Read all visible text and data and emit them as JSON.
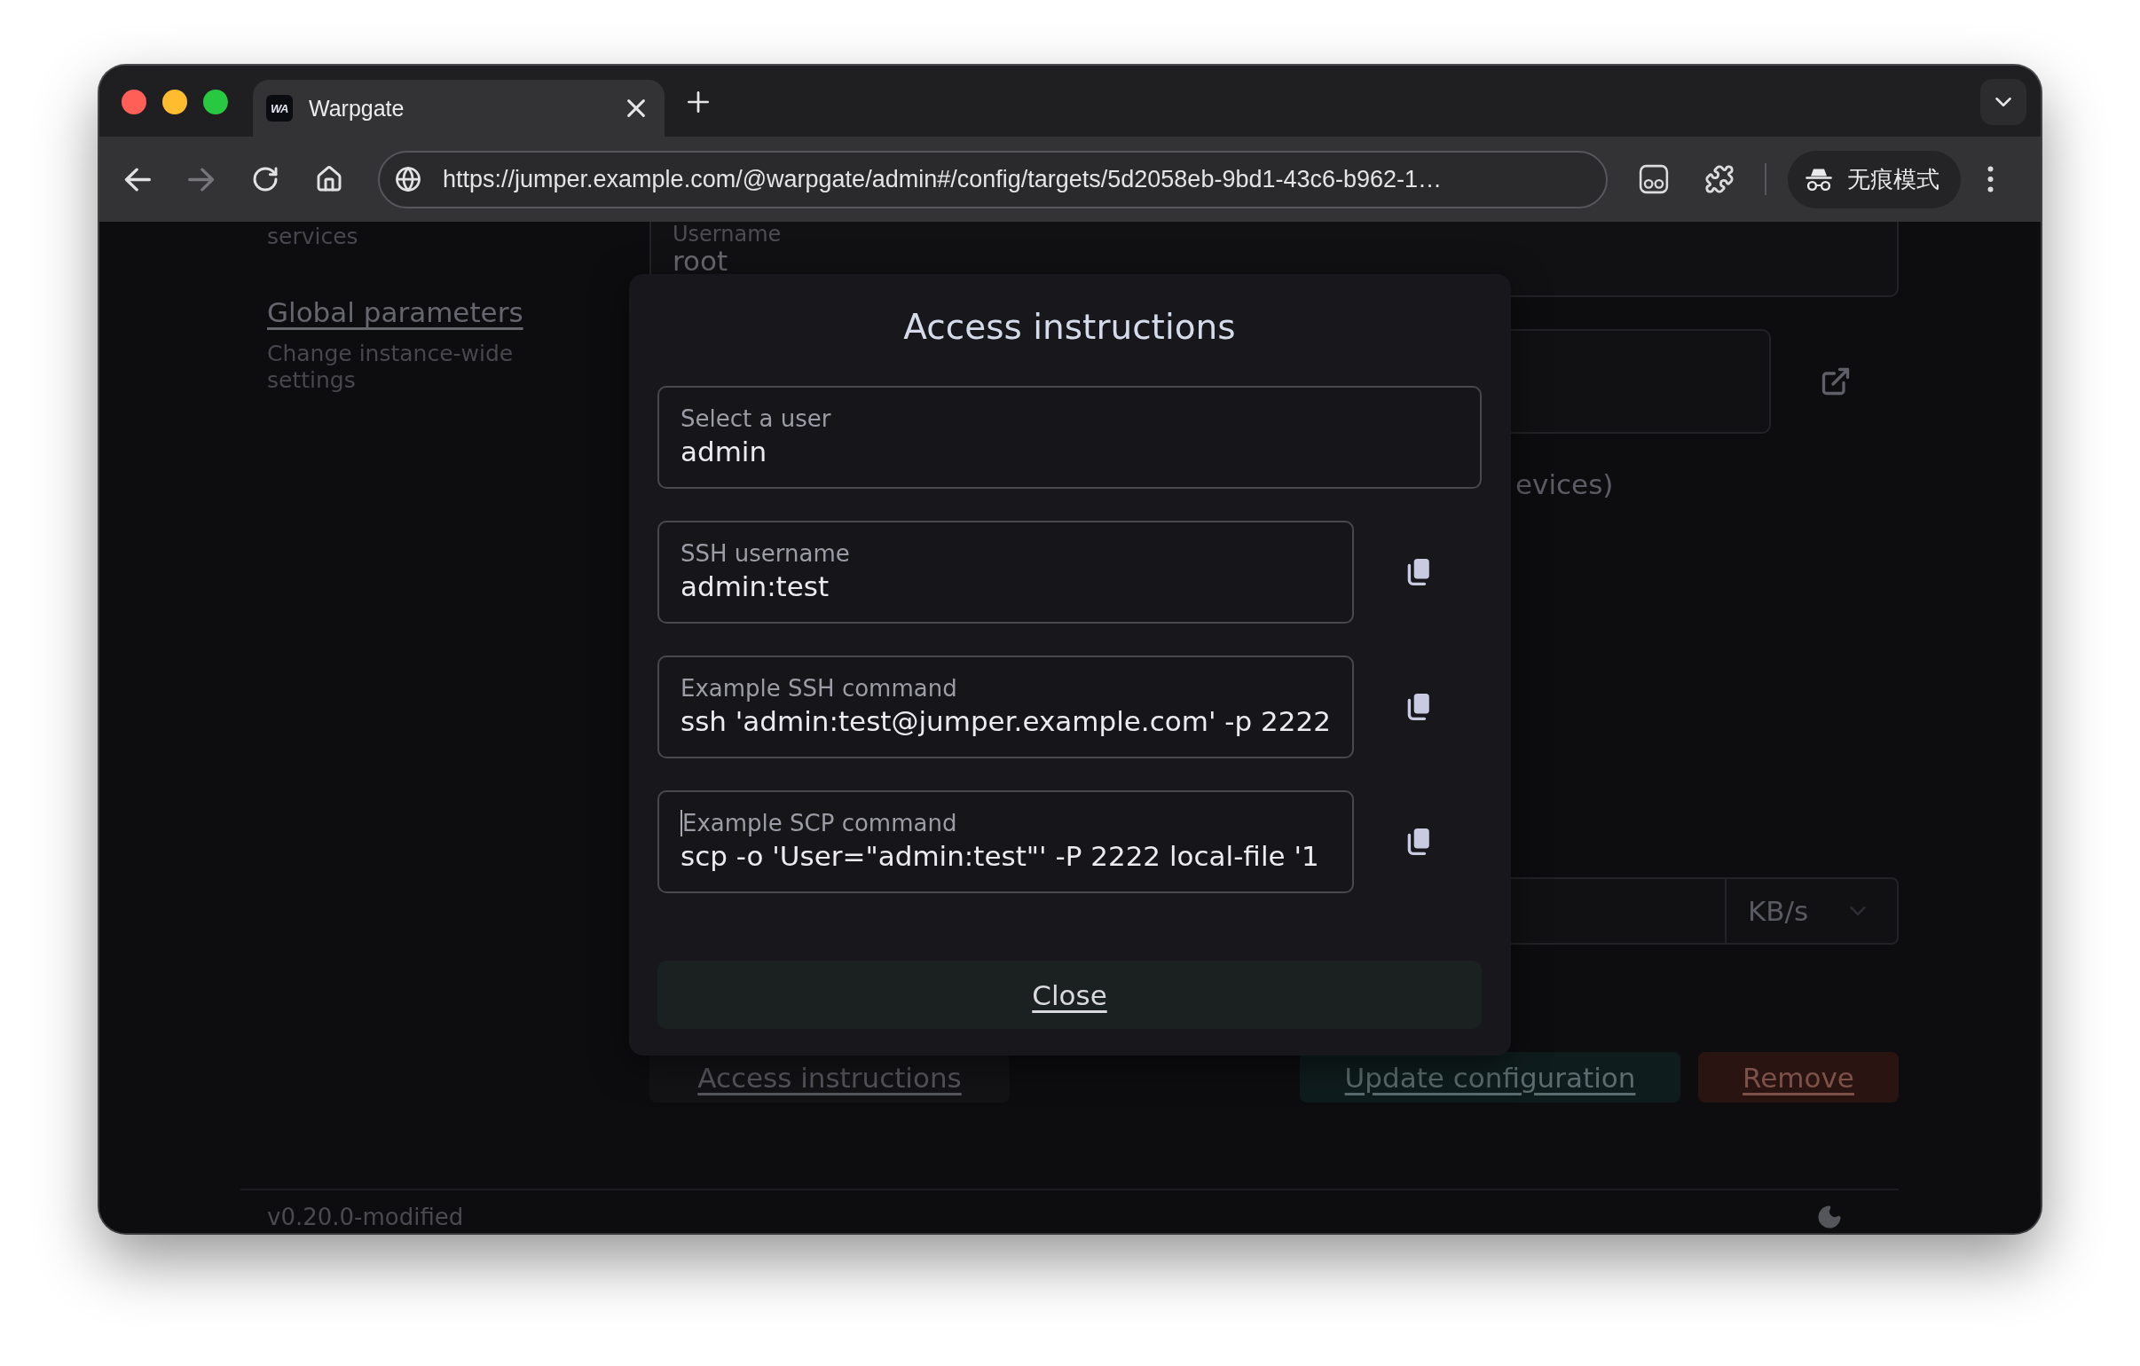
{
  "browser": {
    "tabs": [
      {
        "favicon": "WA",
        "title": "Warpgate",
        "selected": true
      }
    ],
    "nav_buttons": [
      {
        "kind": "back",
        "disabled": false
      },
      {
        "kind": "forward",
        "disabled": true
      },
      {
        "kind": "reload",
        "disabled": false
      },
      {
        "kind": "home",
        "disabled": false
      }
    ],
    "url": "https://jumper.example.com/@warpgate/admin#/config/targets/5d2058eb-9bd1-43c6-b962-1…",
    "incognito_label": "无痕模式"
  },
  "sidebar": {
    "items": [
      {
        "kind": "description",
        "text": "services"
      },
      {
        "kind": "link",
        "text": "Global parameters"
      },
      {
        "kind": "description",
        "text": "Change instance-wide settings"
      }
    ]
  },
  "target_form": {
    "username_field": {
      "label": "Username",
      "value": "root"
    },
    "partial_label": "evices)",
    "rate_limit_unit": "KB/s",
    "buttons": [
      {
        "kind": "secondary",
        "label": "Access instructions"
      },
      {
        "kind": "primary",
        "label": "Update configuration"
      },
      {
        "kind": "danger",
        "label": "Remove"
      }
    ]
  },
  "footer": {
    "version": "v0.20.0-modified"
  },
  "dialog": {
    "title": "Access instructions",
    "fields": [
      {
        "kind": "select",
        "label": "Select a user",
        "value": "admin",
        "focused": false
      },
      {
        "kind": "copyable",
        "label": "SSH username",
        "value": "admin:test",
        "focused": false
      },
      {
        "kind": "copyable",
        "label": "Example SSH command",
        "value": "ssh 'admin:test@jumper.example.com' -p 2222",
        "focused": false
      },
      {
        "kind": "copyable",
        "label": "Example SCP command",
        "value": "scp -o 'User=\"admin:test\"' -P 2222 local-file '1",
        "focused": true
      }
    ],
    "close_label": "Close"
  }
}
